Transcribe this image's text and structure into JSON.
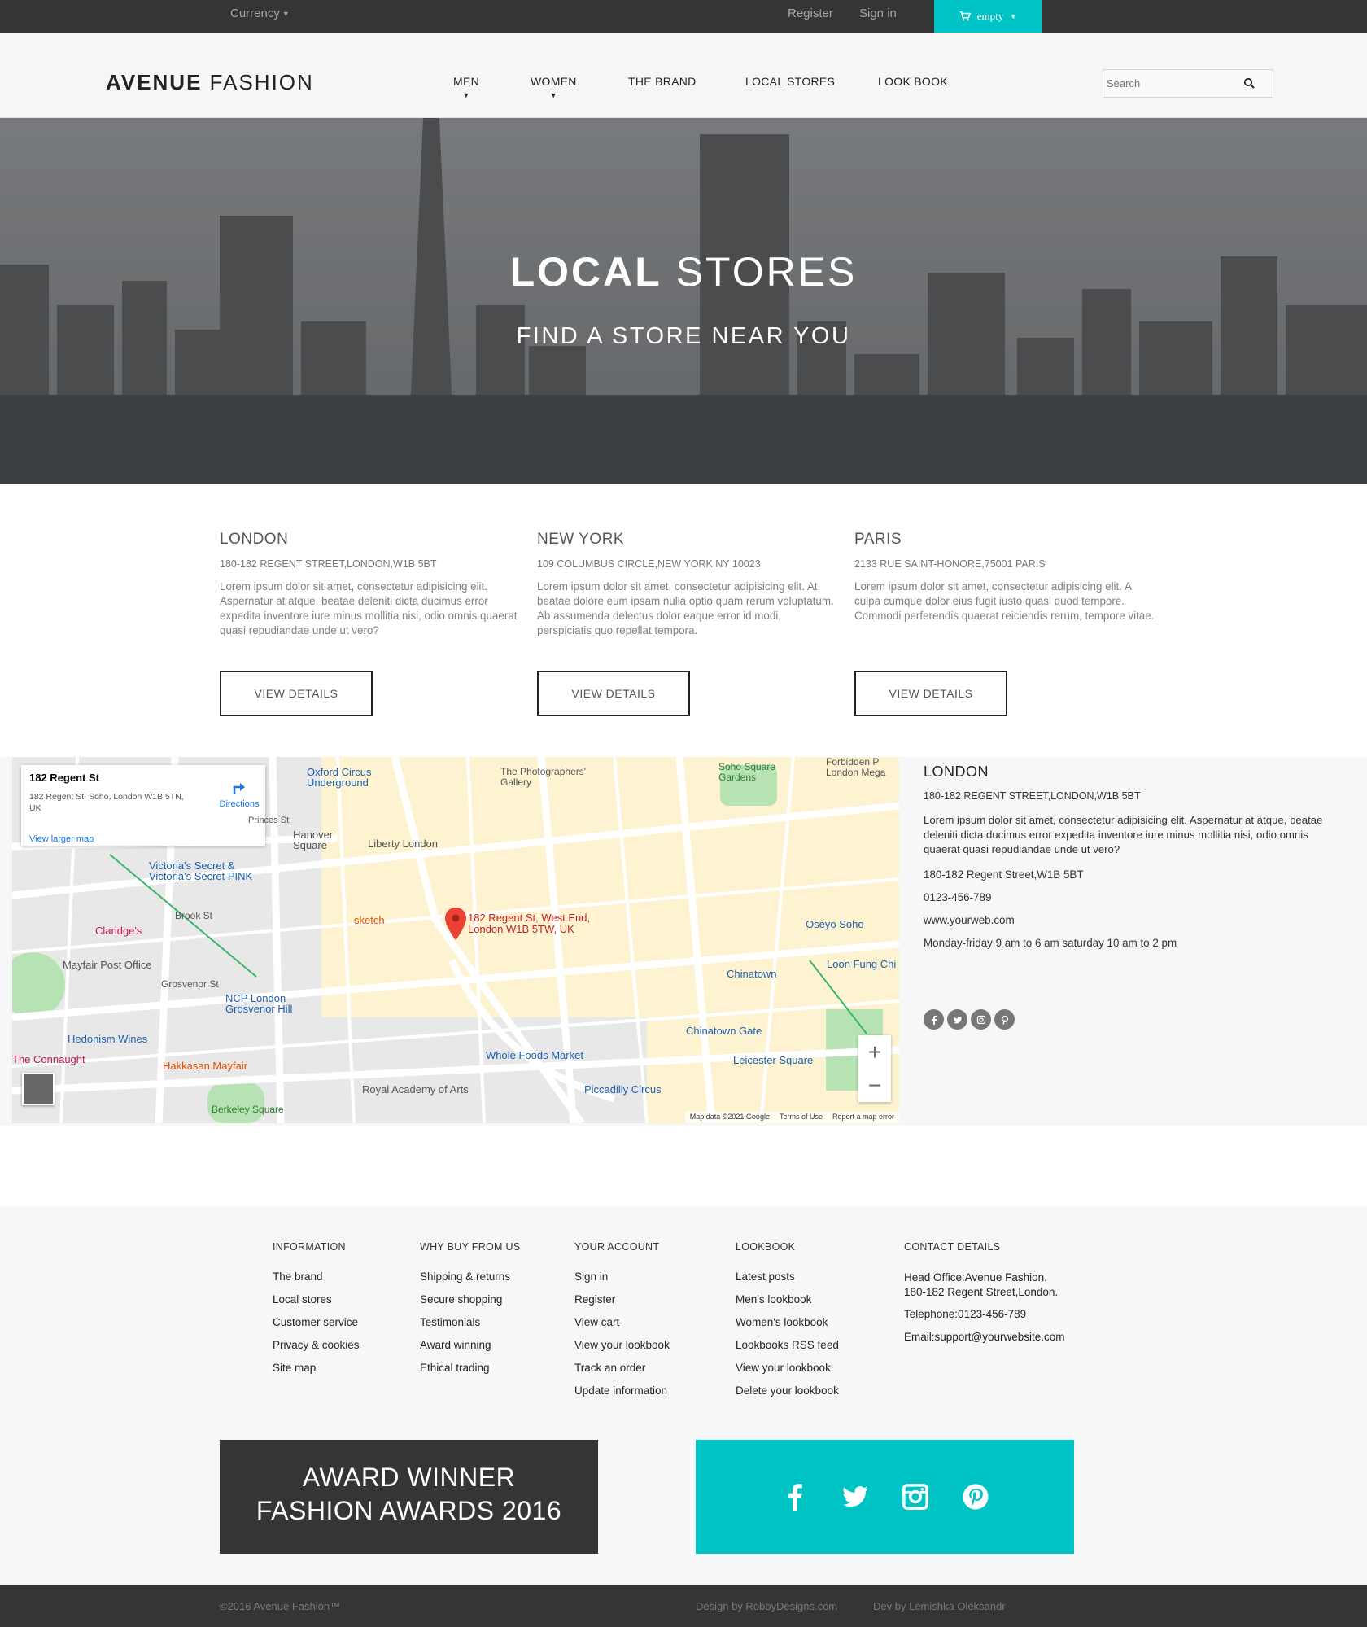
{
  "topbar": {
    "currency": "Currency",
    "register": "Register",
    "signin": "Sign in",
    "cart": "empty",
    "accent": "#00c3c6"
  },
  "header": {
    "logo_bold": "AVENUE",
    "logo_rest": "FASHION",
    "nav": [
      "MEN",
      "WOMEN",
      "THE BRAND",
      "LOCAL STORES",
      "LOOK BOOK"
    ],
    "search_placeholder": "Search"
  },
  "hero": {
    "title_bold": "LOCAL",
    "title_rest": "STORES",
    "subtitle": "FIND A STORE NEAR YOU"
  },
  "stores": [
    {
      "city": "LONDON",
      "address": "180-182 REGENT STREET,LONDON,W1B 5BT",
      "description": "Lorem ipsum dolor sit amet, consectetur adipisicing elit. Aspernatur at atque, beatae deleniti dicta ducimus error expedita inventore iure minus mollitia nisi, odio omnis quaerat quasi repudiandae unde ut vero?",
      "button": "VIEW DETAILS"
    },
    {
      "city": "NEW YORK",
      "address": "109 COLUMBUS CIRCLE,NEW YORK,NY 10023",
      "description": "Lorem ipsum dolor sit amet, consectetur adipisicing elit. At beatae dolore eum ipsam nulla optio quam rerum voluptatum. Ab assumenda delectus dolor eaque error id modi, perspiciatis quo repellat tempora.",
      "button": "VIEW DETAILS"
    },
    {
      "city": "PARIS",
      "address": "2133 RUE SAINT-HONORE,75001 PARIS",
      "description": "Lorem ipsum dolor sit amet, consectetur adipisicing elit. A culpa cumque dolor eius fugit iusto quasi quod tempore. Commodi perferendis quaerat reiciendis rerum, tempore vitae.",
      "button": "VIEW DETAILS"
    }
  ],
  "map": {
    "card_title": "182 Regent St",
    "card_address": "182 Regent St, Soho, London W1B 5TN, UK",
    "directions": "Directions",
    "view_larger": "View larger map",
    "pin_label": "182 Regent St, West End, London W1B 5TW, UK",
    "labels": [
      "Oxford Circus Underground",
      "The Photographers' Gallery",
      "Soho Square Gardens",
      "Liberty London",
      "Hanover Square",
      "Victoria's Secret & Victoria's Secret PINK",
      "Claridge's",
      "sketch",
      "Mayfair Post Office",
      "Brook St",
      "Grosvenor St",
      "NCP London Grosvenor Hill",
      "Hedonism Wines",
      "Hakkasan Mayfair",
      "Whole Foods Market",
      "Royal Academy of Arts",
      "Piccadilly Circus",
      "Chinatown",
      "Chinatown Gate",
      "Leicester Square",
      "Oseyo Soho",
      "Loon Fung Chi",
      "Forbidden P London Mega",
      "Berkeley Square",
      "The Connaught",
      "Princes St"
    ],
    "footer": [
      "Map data ©2021 Google",
      "Terms of Use",
      "Report a map error"
    ],
    "zoom_in": "+",
    "zoom_out": "−"
  },
  "map_info": {
    "city": "LONDON",
    "address": "180-182 REGENT STREET,LONDON,W1B 5BT",
    "description": "Lorem ipsum dolor sit amet, consectetur adipisicing elit. Aspernatur at atque, beatae deleniti dicta ducimus error expedita inventore iure minus mollitia nisi, odio omnis quaerat quasi repudiandae unde ut vero?",
    "street": "180-182 Regent Street,W1B 5BT",
    "phone": "0123-456-789",
    "web": "www.yourweb.com",
    "hours": "Monday-friday 9 am to 6 am saturday 10 am to 2 pm"
  },
  "footer": {
    "columns": [
      {
        "heading": "INFORMATION",
        "links": [
          "The brand",
          "Local stores",
          "Customer service",
          "Privacy & cookies",
          "Site map"
        ]
      },
      {
        "heading": "WHY BUY FROM US",
        "links": [
          "Shipping & returns",
          "Secure shopping",
          "Testimonials",
          "Award winning",
          "Ethical trading"
        ]
      },
      {
        "heading": "YOUR ACCOUNT",
        "links": [
          "Sign in",
          "Register",
          "View cart",
          "View your lookbook",
          "Track an order",
          "Update information"
        ]
      },
      {
        "heading": "LOOKBOOK",
        "links": [
          "Latest posts",
          "Men's lookbook",
          "Women's lookbook",
          "Lookbooks RSS feed",
          "View your lookbook",
          "Delete your lookbook"
        ]
      }
    ],
    "contact": {
      "heading": "CONTACT DETAILS",
      "line1": "Head Office:Avenue Fashion.",
      "line2": "180-182 Regent Street,London.",
      "phone": "Telephone:0123-456-789",
      "email": "Email:support@yourwebsite.com"
    },
    "award_line1": "AWARD WINNER",
    "award_line2": "FASHION AWARDS 2016"
  },
  "bottombar": {
    "copyright": "©2016 Avenue Fashion™",
    "design": "Design by RobbyDesigns.com",
    "dev": "Dev by Lemishka Oleksandr"
  }
}
